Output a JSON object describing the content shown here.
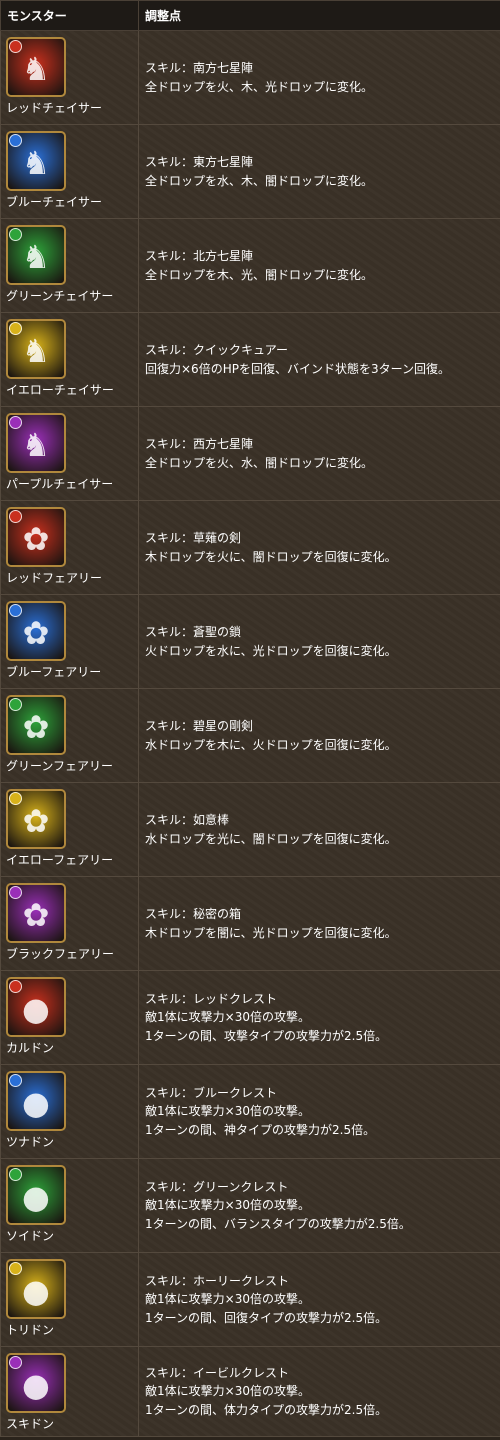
{
  "header": {
    "col_monster": "モンスター",
    "col_adjust": "調整点"
  },
  "colors": {
    "red": "#c9301e",
    "blue": "#2a6fd6",
    "green": "#2ea33a",
    "yellow": "#d8b21a",
    "purple": "#9a2fb8"
  },
  "rows": [
    {
      "name": "レッドチェイサー",
      "icon": "red-chaser-icon",
      "attr": "red",
      "glyph": "♞",
      "lines": [
        "スキル：南方七星陣",
        "全ドロップを火、木、光ドロップに変化。"
      ]
    },
    {
      "name": "ブルーチェイサー",
      "icon": "blue-chaser-icon",
      "attr": "blue",
      "glyph": "♞",
      "lines": [
        "スキル：東方七星陣",
        "全ドロップを水、木、闇ドロップに変化。"
      ]
    },
    {
      "name": "グリーンチェイサー",
      "icon": "green-chaser-icon",
      "attr": "green",
      "glyph": "♞",
      "lines": [
        "スキル：北方七星陣",
        "全ドロップを木、光、闇ドロップに変化。"
      ]
    },
    {
      "name": "イエローチェイサー",
      "icon": "yellow-chaser-icon",
      "attr": "yellow",
      "glyph": "♞",
      "lines": [
        "スキル：クイックキュアー",
        "回復力×6倍のHPを回復、バインド状態を3ターン回復。"
      ]
    },
    {
      "name": "パープルチェイサー",
      "icon": "purple-chaser-icon",
      "attr": "purple",
      "glyph": "♞",
      "lines": [
        "スキル：西方七星陣",
        "全ドロップを火、水、闇ドロップに変化。"
      ]
    },
    {
      "name": "レッドフェアリー",
      "icon": "red-fairy-icon",
      "attr": "red",
      "glyph": "✿",
      "lines": [
        "スキル：草薙の剣",
        "木ドロップを火に、闇ドロップを回復に変化。"
      ]
    },
    {
      "name": "ブルーフェアリー",
      "icon": "blue-fairy-icon",
      "attr": "blue",
      "glyph": "✿",
      "lines": [
        "スキル：蒼聖の鎖",
        "火ドロップを水に、光ドロップを回復に変化。"
      ]
    },
    {
      "name": "グリーンフェアリー",
      "icon": "green-fairy-icon",
      "attr": "green",
      "glyph": "✿",
      "lines": [
        "スキル：碧星の剛剣",
        "水ドロップを木に、火ドロップを回復に変化。"
      ]
    },
    {
      "name": "イエローフェアリー",
      "icon": "yellow-fairy-icon",
      "attr": "yellow",
      "glyph": "✿",
      "lines": [
        "スキル：如意棒",
        "水ドロップを光に、闇ドロップを回復に変化。"
      ]
    },
    {
      "name": "ブラックフェアリー",
      "icon": "black-fairy-icon",
      "attr": "purple",
      "glyph": "✿",
      "lines": [
        "スキル：秘密の箱",
        "木ドロップを闇に、光ドロップを回復に変化。"
      ]
    },
    {
      "name": "カルドン",
      "icon": "kaldon-icon",
      "attr": "red",
      "glyph": "●",
      "lines": [
        "スキル：レッドクレスト",
        "敵1体に攻撃力×30倍の攻撃。",
        "1ターンの間、攻撃タイプの攻撃力が2.5倍。"
      ]
    },
    {
      "name": "ツナドン",
      "icon": "tsunadon-icon",
      "attr": "blue",
      "glyph": "●",
      "lines": [
        "スキル：ブルークレスト",
        "敵1体に攻撃力×30倍の攻撃。",
        "1ターンの間、神タイプの攻撃力が2.5倍。"
      ]
    },
    {
      "name": "ソイドン",
      "icon": "soidon-icon",
      "attr": "green",
      "glyph": "●",
      "lines": [
        "スキル：グリーンクレスト",
        "敵1体に攻撃力×30倍の攻撃。",
        "1ターンの間、バランスタイプの攻撃力が2.5倍。"
      ]
    },
    {
      "name": "トリドン",
      "icon": "toridon-icon",
      "attr": "yellow",
      "glyph": "●",
      "lines": [
        "スキル：ホーリークレスト",
        "敵1体に攻撃力×30倍の攻撃。",
        "1ターンの間、回復タイプの攻撃力が2.5倍。"
      ]
    },
    {
      "name": "スキドン",
      "icon": "sukidon-icon",
      "attr": "purple",
      "glyph": "●",
      "lines": [
        "スキル：イービルクレスト",
        "敵1体に攻撃力×30倍の攻撃。",
        "1ターンの間、体力タイプの攻撃力が2.5倍。"
      ]
    }
  ]
}
